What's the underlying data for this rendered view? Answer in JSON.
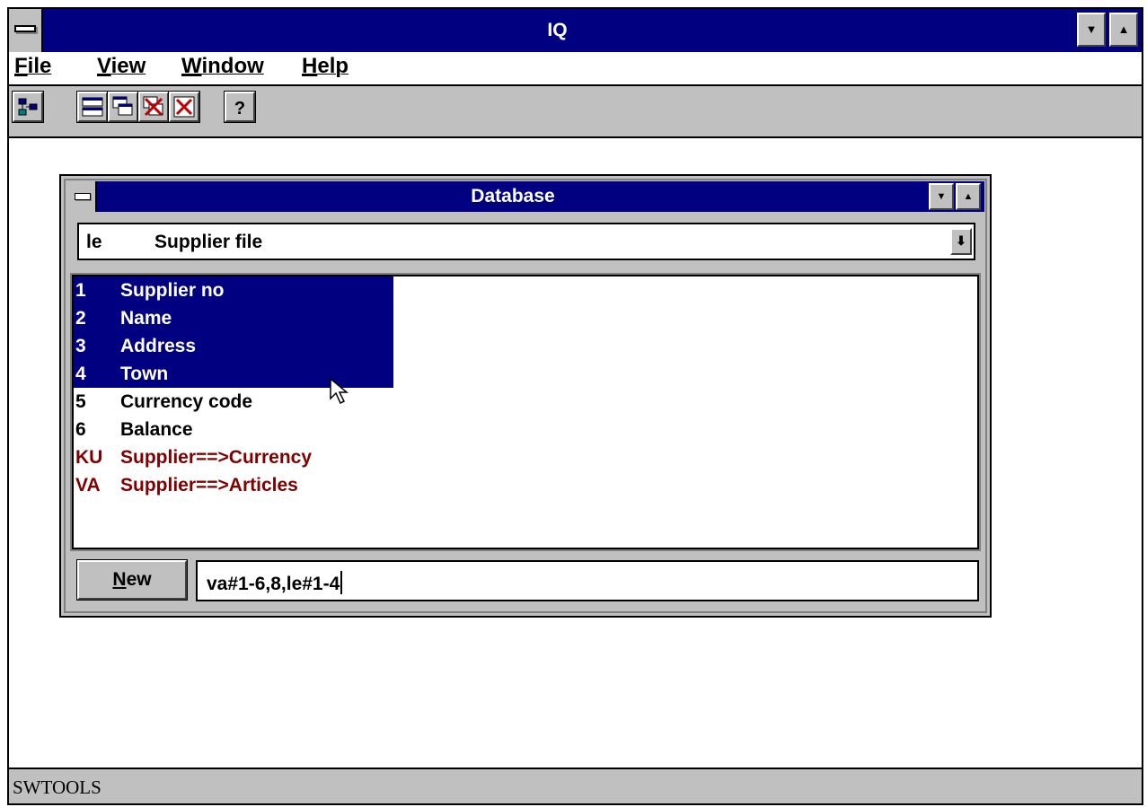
{
  "app": {
    "title": "IQ"
  },
  "menu": {
    "items": [
      {
        "label": "File",
        "accel": "F",
        "rest": "ile"
      },
      {
        "label": "View",
        "accel": "V",
        "rest": "iew"
      },
      {
        "label": "Window",
        "accel": "W",
        "rest": "indow"
      },
      {
        "label": "Help",
        "accel": "H",
        "rest": "elp"
      }
    ]
  },
  "toolbar": {
    "buttons": [
      "tree-icon",
      "tile-icon",
      "cascade-icon",
      "close-all-icon",
      "close-icon",
      "help-icon"
    ],
    "help_glyph": "?"
  },
  "db_window": {
    "title": "Database",
    "combo": {
      "code": "le",
      "name": "Supplier file"
    },
    "fields": [
      {
        "num": "1",
        "name": "Supplier no",
        "state": "selected"
      },
      {
        "num": "2",
        "name": "Name",
        "state": "selected"
      },
      {
        "num": "3",
        "name": "Address",
        "state": "selected"
      },
      {
        "num": "4",
        "name": "Town",
        "state": "selected"
      },
      {
        "num": "5",
        "name": "Currency code",
        "state": "normal"
      },
      {
        "num": "6",
        "name": "Balance",
        "state": "normal"
      },
      {
        "num": "KU",
        "name": "Supplier==>Currency",
        "state": "link"
      },
      {
        "num": "VA",
        "name": "Supplier==>Articles",
        "state": "link"
      }
    ],
    "new_button": {
      "accel": "N",
      "rest": "ew"
    },
    "query_value": "va#1-6,8,le#1-4"
  },
  "status": {
    "text": "SWTOOLS"
  },
  "colors": {
    "title_bar": "#000080",
    "chrome": "#c0c0c0",
    "link_text": "#800000"
  }
}
